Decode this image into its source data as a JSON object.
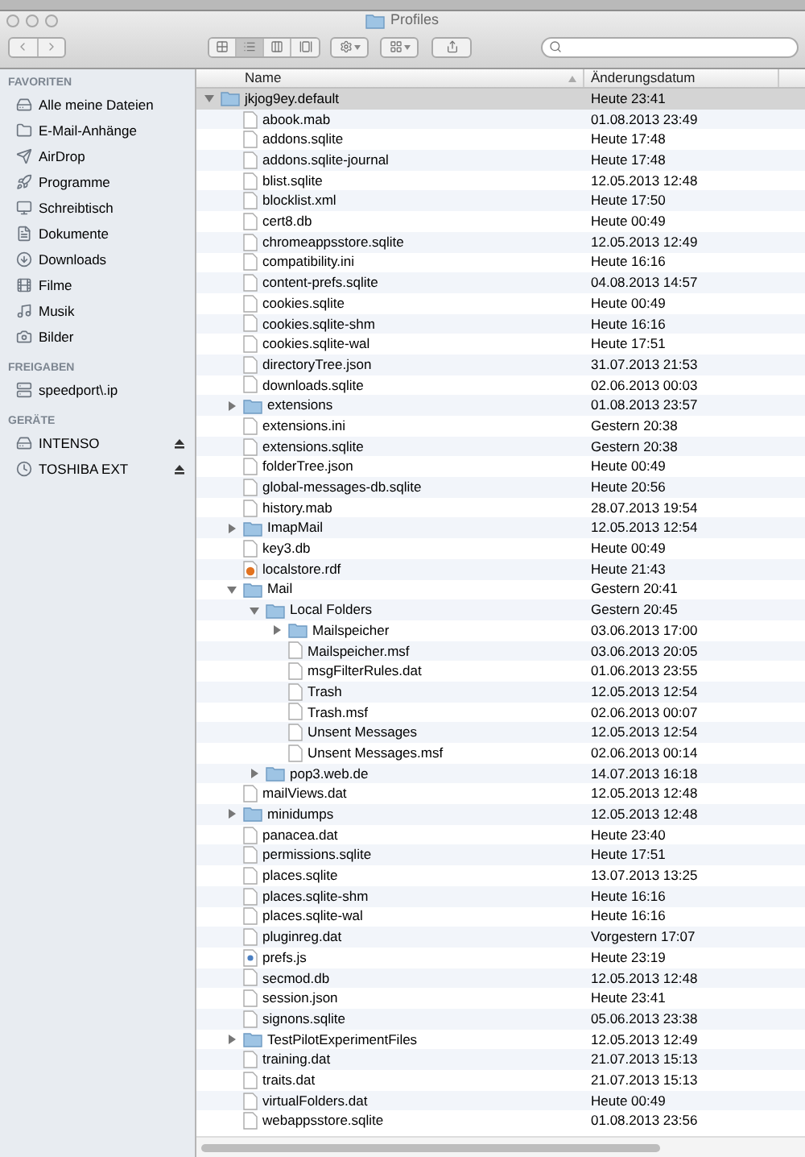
{
  "window": {
    "title": "Profiles"
  },
  "toolbar": {
    "views": [
      {
        "kind": "icons",
        "selected": false
      },
      {
        "kind": "list",
        "selected": true
      },
      {
        "kind": "columns",
        "selected": false
      },
      {
        "kind": "coverflow",
        "selected": false
      }
    ]
  },
  "sidebar": {
    "sections": [
      {
        "title": "FAVORITEN",
        "items": [
          {
            "label": "Alle meine Dateien",
            "kind": "files"
          },
          {
            "label": "E-Mail-Anhänge",
            "kind": "folder"
          },
          {
            "label": "AirDrop",
            "kind": "airdrop"
          },
          {
            "label": "Programme",
            "kind": "apps"
          },
          {
            "label": "Schreibtisch",
            "kind": "desktop"
          },
          {
            "label": "Dokumente",
            "kind": "documents"
          },
          {
            "label": "Downloads",
            "kind": "downloads"
          },
          {
            "label": "Filme",
            "kind": "movies"
          },
          {
            "label": "Musik",
            "kind": "music"
          },
          {
            "label": "Bilder",
            "kind": "pictures"
          }
        ]
      },
      {
        "title": "FREIGABEN",
        "items": [
          {
            "label": "speedport\\.ip",
            "kind": "server"
          }
        ]
      },
      {
        "title": "GERÄTE",
        "items": [
          {
            "label": "INTENSO",
            "kind": "disk",
            "ejectable": true
          },
          {
            "label": "TOSHIBA EXT",
            "kind": "timemachine",
            "ejectable": true
          }
        ]
      }
    ]
  },
  "table": {
    "columns": [
      "Name",
      "Änderungsdatum"
    ],
    "rows": [
      {
        "name": "jkjog9ey.default",
        "date": "Heute 23:41",
        "kind": "folder",
        "expanded": true,
        "selected": true,
        "children": [
          {
            "name": "abook.mab",
            "date": "01.08.2013 23:49",
            "kind": "file",
            "selected": false
          },
          {
            "name": "addons.sqlite",
            "date": "Heute 17:48",
            "kind": "file",
            "selected": false
          },
          {
            "name": "addons.sqlite-journal",
            "date": "Heute 17:48",
            "kind": "file",
            "selected": false
          },
          {
            "name": "blist.sqlite",
            "date": "12.05.2013 12:48",
            "kind": "file",
            "selected": false
          },
          {
            "name": "blocklist.xml",
            "date": "Heute 17:50",
            "kind": "file",
            "selected": false
          },
          {
            "name": "cert8.db",
            "date": "Heute 00:49",
            "kind": "file",
            "selected": false
          },
          {
            "name": "chromeappsstore.sqlite",
            "date": "12.05.2013 12:49",
            "kind": "file",
            "selected": false
          },
          {
            "name": "compatibility.ini",
            "date": "Heute 16:16",
            "kind": "file",
            "selected": false
          },
          {
            "name": "content-prefs.sqlite",
            "date": "04.08.2013 14:57",
            "kind": "file",
            "selected": false
          },
          {
            "name": "cookies.sqlite",
            "date": "Heute 00:49",
            "kind": "file",
            "selected": false
          },
          {
            "name": "cookies.sqlite-shm",
            "date": "Heute 16:16",
            "kind": "file",
            "selected": false
          },
          {
            "name": "cookies.sqlite-wal",
            "date": "Heute 17:51",
            "kind": "file",
            "selected": false
          },
          {
            "name": "directoryTree.json",
            "date": "31.07.2013 21:53",
            "kind": "file",
            "selected": false
          },
          {
            "name": "downloads.sqlite",
            "date": "02.06.2013 00:03",
            "kind": "file",
            "selected": false
          },
          {
            "name": "extensions",
            "date": "01.08.2013 23:57",
            "kind": "folder",
            "expanded": false,
            "selected": false
          },
          {
            "name": "extensions.ini",
            "date": "Gestern 20:38",
            "kind": "file",
            "selected": false
          },
          {
            "name": "extensions.sqlite",
            "date": "Gestern 20:38",
            "kind": "file",
            "selected": false
          },
          {
            "name": "folderTree.json",
            "date": "Heute 00:49",
            "kind": "file",
            "selected": false
          },
          {
            "name": "global-messages-db.sqlite",
            "date": "Heute 20:56",
            "kind": "file",
            "selected": false
          },
          {
            "name": "history.mab",
            "date": "28.07.2013 19:54",
            "kind": "file",
            "selected": false
          },
          {
            "name": "ImapMail",
            "date": "12.05.2013 12:54",
            "kind": "folder",
            "expanded": false,
            "selected": false
          },
          {
            "name": "key3.db",
            "date": "Heute 00:49",
            "kind": "file",
            "selected": false
          },
          {
            "name": "localstore.rdf",
            "date": "Heute 21:43",
            "kind": "rdf",
            "selected": false
          },
          {
            "name": "Mail",
            "date": "Gestern 20:41",
            "kind": "folder",
            "expanded": true,
            "selected": false,
            "children": [
              {
                "name": "Local Folders",
                "date": "Gestern 20:45",
                "kind": "folder",
                "expanded": true,
                "selected": false,
                "children": [
                  {
                    "name": "Mailspeicher",
                    "date": "03.06.2013 17:00",
                    "kind": "folder",
                    "expanded": false,
                    "selected": false
                  },
                  {
                    "name": "Mailspeicher.msf",
                    "date": "03.06.2013 20:05",
                    "kind": "file",
                    "selected": false
                  },
                  {
                    "name": "msgFilterRules.dat",
                    "date": "01.06.2013 23:55",
                    "kind": "file",
                    "selected": false
                  },
                  {
                    "name": "Trash",
                    "date": "12.05.2013 12:54",
                    "kind": "file",
                    "selected": false
                  },
                  {
                    "name": "Trash.msf",
                    "date": "02.06.2013 00:07",
                    "kind": "file",
                    "selected": false
                  },
                  {
                    "name": "Unsent Messages",
                    "date": "12.05.2013 12:54",
                    "kind": "file",
                    "selected": false
                  },
                  {
                    "name": "Unsent Messages.msf",
                    "date": "02.06.2013 00:14",
                    "kind": "file",
                    "selected": false
                  }
                ]
              },
              {
                "name": "pop3.web.de",
                "date": "14.07.2013 16:18",
                "kind": "folder",
                "expanded": false,
                "selected": false
              }
            ]
          },
          {
            "name": "mailViews.dat",
            "date": "12.05.2013 12:48",
            "kind": "file",
            "selected": false
          },
          {
            "name": "minidumps",
            "date": "12.05.2013 12:48",
            "kind": "folder",
            "expanded": false,
            "selected": false
          },
          {
            "name": "panacea.dat",
            "date": "Heute 23:40",
            "kind": "file",
            "selected": false
          },
          {
            "name": "permissions.sqlite",
            "date": "Heute 17:51",
            "kind": "file",
            "selected": false
          },
          {
            "name": "places.sqlite",
            "date": "13.07.2013 13:25",
            "kind": "file",
            "selected": false
          },
          {
            "name": "places.sqlite-shm",
            "date": "Heute 16:16",
            "kind": "file",
            "selected": false
          },
          {
            "name": "places.sqlite-wal",
            "date": "Heute 16:16",
            "kind": "file",
            "selected": false
          },
          {
            "name": "pluginreg.dat",
            "date": "Vorgestern 17:07",
            "kind": "file",
            "selected": false
          },
          {
            "name": "prefs.js",
            "date": "Heute 23:19",
            "kind": "script",
            "selected": false
          },
          {
            "name": "secmod.db",
            "date": "12.05.2013 12:48",
            "kind": "file",
            "selected": false
          },
          {
            "name": "session.json",
            "date": "Heute 23:41",
            "kind": "file",
            "selected": false
          },
          {
            "name": "signons.sqlite",
            "date": "05.06.2013 23:38",
            "kind": "file",
            "selected": false
          },
          {
            "name": "TestPilotExperimentFiles",
            "date": "12.05.2013 12:49",
            "kind": "folder",
            "expanded": false,
            "selected": false
          },
          {
            "name": "training.dat",
            "date": "21.07.2013 15:13",
            "kind": "file",
            "selected": false
          },
          {
            "name": "traits.dat",
            "date": "21.07.2013 15:13",
            "kind": "file",
            "selected": false
          },
          {
            "name": "virtualFolders.dat",
            "date": "Heute 00:49",
            "kind": "file",
            "selected": false
          },
          {
            "name": "webappsstore.sqlite",
            "date": "01.08.2013 23:56",
            "kind": "file",
            "selected": false
          }
        ]
      }
    ]
  }
}
